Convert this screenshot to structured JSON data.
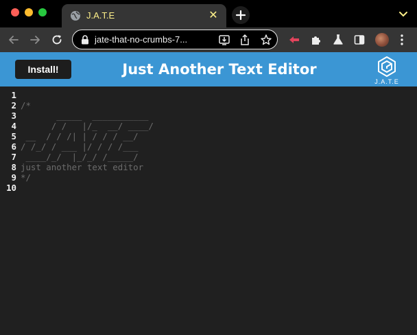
{
  "browser": {
    "tab": {
      "title": "J.A.T.E",
      "close": "✕"
    },
    "url": "jate-that-no-crumbs-7..."
  },
  "app": {
    "install_label": "Install!",
    "title": "Just Another Text Editor",
    "logo_text": "J.A.T.E"
  },
  "editor": {
    "lines": [
      {
        "n": "1",
        "text": ""
      },
      {
        "n": "2",
        "text": "/*"
      },
      {
        "n": "3",
        "text": "       _____  ___________"
      },
      {
        "n": "4",
        "text": "      / /   |/_  __/ ____/"
      },
      {
        "n": "5",
        "text": " __  / / /| | / / / __/"
      },
      {
        "n": "6",
        "text": "/ /_/ / ___ |/ / / /___"
      },
      {
        "n": "7",
        "text": " ____/_/  |_/_/ /_____/"
      },
      {
        "n": "8",
        "text": "just another text editor"
      },
      {
        "n": "9",
        "text": "*/"
      },
      {
        "n": "10",
        "text": ""
      }
    ]
  },
  "colors": {
    "header": "#3b96d4",
    "editor_bg": "#202020",
    "comment": "#6c6c6c",
    "tab_title": "#fef08a"
  }
}
